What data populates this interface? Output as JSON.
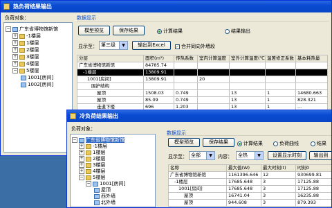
{
  "win1": {
    "title": "热负荷结果输出",
    "obj_label": "负荷对象：",
    "tree": [
      {
        "label": "广东省博物馆新馆",
        "type": "root"
      },
      {
        "label": "-1楼层",
        "type": "floor"
      },
      {
        "label": "1楼层",
        "type": "floor"
      },
      {
        "label": "2楼层",
        "type": "floor"
      },
      {
        "label": "3楼层",
        "type": "floor"
      },
      {
        "label": "4楼层",
        "type": "floor"
      },
      {
        "label": "5楼层",
        "type": "floor"
      },
      {
        "label": "1001[房间]",
        "type": "room"
      },
      {
        "label": "1002[房间]",
        "type": "room"
      }
    ],
    "data_display_label": "数据显示",
    "btn_model_preview": "模型预览",
    "btn_save_result": "保存结果",
    "radio_calc_result": "计算结果",
    "radio_result_output": "结果输出",
    "show_to_label": "显示至：",
    "show_to_value": "第三级",
    "btn_export_excel": "输出到Excel",
    "chk_merge": "合并同向外墙段",
    "table": {
      "headers": [
        "分层",
        "面积(m²)",
        "传热系数",
        "室内计算温度",
        "室外计算温度(℃)",
        "温差修正系数",
        "基本耗热量"
      ],
      "rows": [
        [
          "广东省博物馆新馆",
          "84785.74",
          "",
          "",
          "",
          "",
          ""
        ],
        [
          "-1楼层",
          "13809.91",
          "",
          "",
          "",
          "",
          ""
        ],
        [
          "1001[房间]",
          "13809.91",
          "",
          "20",
          "",
          "",
          ""
        ],
        [
          "围护结构",
          "",
          "",
          "",
          "",
          "",
          ""
        ],
        [
          "屋顶",
          "1508.03",
          "0.749",
          "",
          "13",
          "1",
          "14680.663"
        ],
        [
          "屋顶",
          "85.09",
          "0.749",
          "",
          "13",
          "1",
          "828.321"
        ],
        [
          "走道下楼",
          "696",
          "1.203",
          "",
          "13",
          "1",
          "..."
        ]
      ]
    }
  },
  "win2": {
    "title": "冷负荷结果输出",
    "obj_label": "负荷对象：",
    "tree": [
      {
        "label": "广东省博物馆新馆",
        "type": "root"
      },
      {
        "label": "-1楼层",
        "type": "floor"
      },
      {
        "label": "1楼层",
        "type": "floor"
      },
      {
        "label": "2楼层",
        "type": "floor"
      },
      {
        "label": "3楼层",
        "type": "floor"
      },
      {
        "label": "4楼层",
        "type": "floor"
      },
      {
        "label": "5楼层",
        "type": "floor"
      },
      {
        "label": "1001[房间]",
        "type": "room"
      },
      {
        "label": "屋顶",
        "type": "item"
      },
      {
        "label": "西外墙",
        "type": "item"
      },
      {
        "label": "北外墙",
        "type": "item"
      }
    ],
    "data_display_label": "数据显示",
    "btn_model_preview": "模型预览",
    "btn_save_result": "保存结果",
    "radio_calc_result": "计算结果",
    "radio_dynamic_curve": "负荷曲线",
    "radio_result_output": "结果",
    "show_to_label": "显示至：",
    "show_to_value": "全部",
    "content_label": "内容：",
    "content_value": "全热",
    "btn_set_display_time": "设置显示时刻",
    "btn_export": "输出到",
    "table": {
      "headers": [
        "名称",
        "最大值(W)",
        "最大时刻(t)",
        "时刻0"
      ],
      "rows": [
        [
          "广东省博物馆新馆",
          "1161396.646",
          "12",
          "930699.81"
        ],
        [
          "-1楼层",
          "17685.648",
          "3",
          "17125.88"
        ],
        [
          "1001[房间]",
          "17685.648",
          "3",
          "17125.88"
        ],
        [
          "屋顶",
          "16741.04",
          "3",
          "16235.88"
        ],
        [
          "屋顶",
          "944.608",
          "3",
          "879.393"
        ]
      ]
    }
  }
}
